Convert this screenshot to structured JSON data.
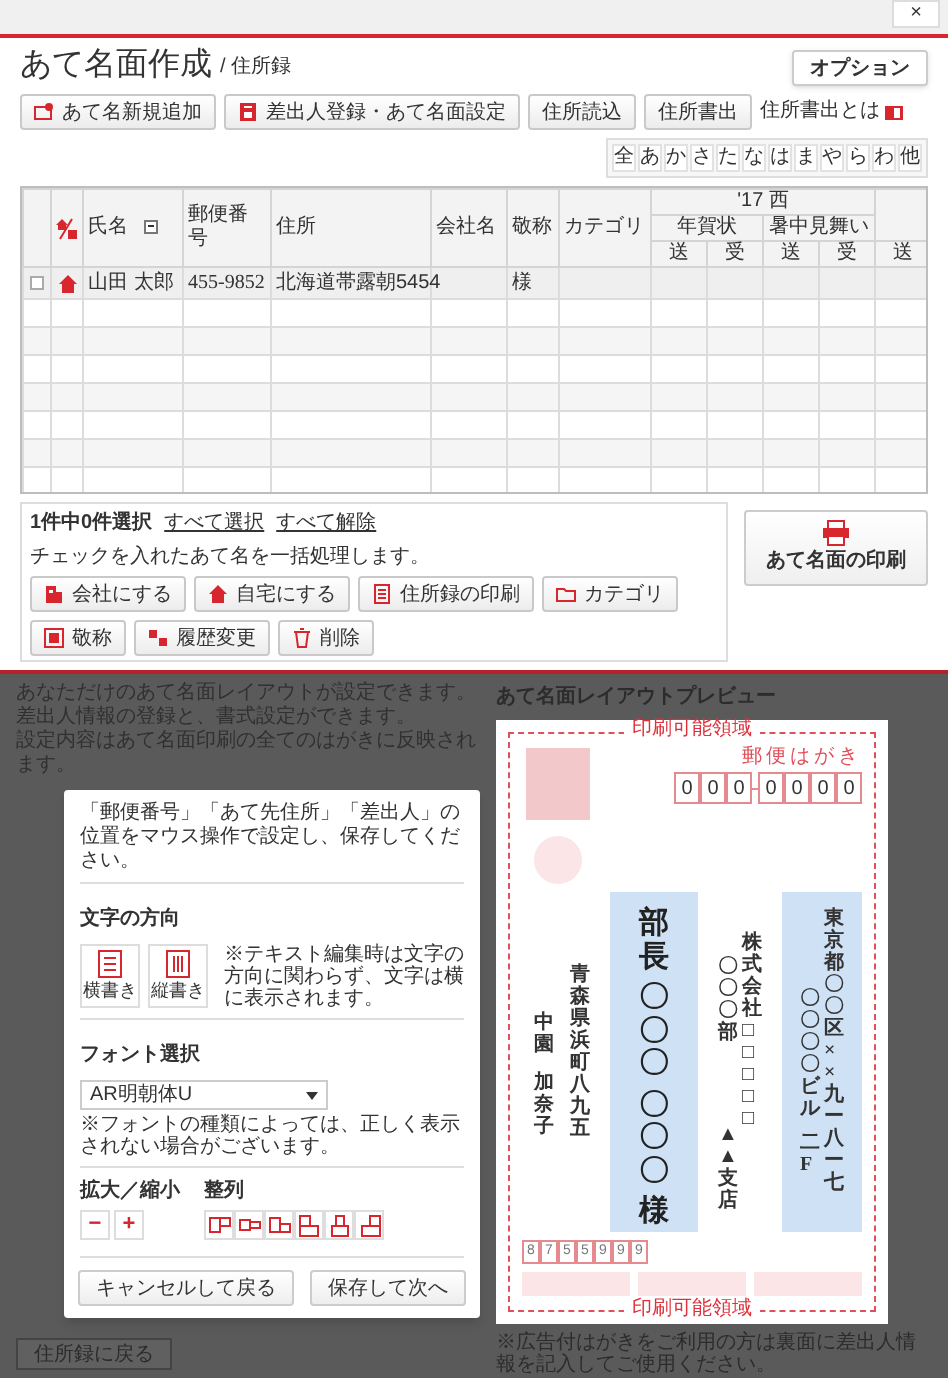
{
  "window": {
    "close": "×"
  },
  "header": {
    "title": "あて名面作成",
    "subtitle": "/ 住所録",
    "option_button": "オプション"
  },
  "toolbar": {
    "buttons": [
      "あて名新規追加",
      "差出人登録・あて名面設定",
      "住所読込",
      "住所書出"
    ],
    "help_link": "住所書出とは",
    "kana_index": [
      "全",
      "あ",
      "か",
      "さ",
      "た",
      "な",
      "は",
      "ま",
      "や",
      "ら",
      "わ",
      "他"
    ]
  },
  "table": {
    "columns": [
      "氏名",
      "郵便番号",
      "住所",
      "会社名",
      "敬称",
      "カテゴリ"
    ],
    "group": {
      "label": "'17 西",
      "subgroups": [
        {
          "label": "年賀状",
          "subs": [
            "送",
            "受"
          ]
        },
        {
          "label": "暑中見舞い",
          "subs": [
            "送",
            "受"
          ]
        }
      ],
      "trailing_sub": "送"
    },
    "rows": [
      {
        "checked": false,
        "kind": "home",
        "name": "山田 太郎",
        "postal": "455-9852",
        "address": "北海道帯露朝5454",
        "honorific": "様"
      }
    ]
  },
  "selection": {
    "status": "1件中0件選択",
    "links": [
      "すべて選択",
      "すべて解除"
    ],
    "hint": "チェックを入れたあて名を一括処理します。",
    "buttons": [
      "会社にする",
      "自宅にする",
      "住所録の印刷",
      "カテゴリ",
      "敬称",
      "履歴変更",
      "削除"
    ]
  },
  "print_button": "あて名面の印刷",
  "background": {
    "intro": [
      "あなただけのあて名面レイアウトが設定できます。",
      "差出人情報の登録と、書式設定ができます。",
      "設定内容はあて名面印刷の全てのはがきに反映されます。"
    ],
    "back_button": "住所録に戻る"
  },
  "dialog": {
    "instruction": "「郵便番号」「あて先住所」「差出人」の位置をマウス操作で設定し、保存してください。",
    "direction": {
      "heading": "文字の方向",
      "options": [
        "横書き",
        "縦書き"
      ],
      "note": "※テキスト編集時は文字の方向に関わらず、文字は横に表示されます。"
    },
    "font": {
      "heading": "フォント選択",
      "value": "AR明朝体U",
      "note": "※フォントの種類によっては、正しく表示されない場合がございます。"
    },
    "zoom": {
      "heading": "拡大／縮小",
      "buttons": [
        "−",
        "+"
      ]
    },
    "align": {
      "heading": "整列"
    },
    "buttons": [
      "キャンセルして戻る",
      "保存して次へ"
    ]
  },
  "preview": {
    "heading": "あて名面レイアウトプレビュー",
    "area_label_top": "印刷可能領域",
    "postcard_label": "郵便はがき",
    "postal_digits": [
      "0",
      "0",
      "0",
      "0",
      "0",
      "0",
      "0"
    ],
    "address": [
      [
        "東京都〇〇区××九ー八ー七"
      ],
      [
        "〇〇〇〇ビル",
        "二F"
      ]
    ],
    "company": [
      "株式会社□□□□□",
      "〇〇〇部",
      "▲▲支店"
    ],
    "recipient": [
      "部長",
      "〇〇〇",
      "〇〇〇",
      "様"
    ],
    "sender": {
      "address": "青森県浜町八九五",
      "name": [
        "中園",
        "加奈子"
      ],
      "postal_digits": [
        "8",
        "7",
        "5",
        "5",
        "9",
        "9",
        "9"
      ]
    },
    "area_label_bottom": "印刷可能領域",
    "note": "※広告付はがきをご利用の方は裏面に差出人情報を記入してご使用ください。"
  }
}
